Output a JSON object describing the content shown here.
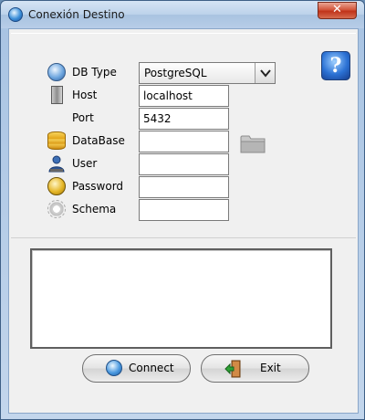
{
  "window": {
    "title": "Conexión Destino",
    "close_label": "✕"
  },
  "help": {
    "label": "?"
  },
  "form": {
    "db_type": {
      "label": "DB Type",
      "selected": "PostgreSQL"
    },
    "host": {
      "label": "Host",
      "value": "localhost"
    },
    "port": {
      "label": "Port",
      "value": "5432"
    },
    "database": {
      "label": "DataBase",
      "value": ""
    },
    "user": {
      "label": "User",
      "value": ""
    },
    "password": {
      "label": "Password",
      "value": ""
    },
    "schema": {
      "label": "Schema",
      "value": ""
    }
  },
  "buttons": {
    "connect": "Connect",
    "exit": "Exit"
  },
  "colors": {
    "window_frame": "#a9c4e3",
    "client_bg": "#f0f0f0",
    "close_red": "#c0331a"
  }
}
